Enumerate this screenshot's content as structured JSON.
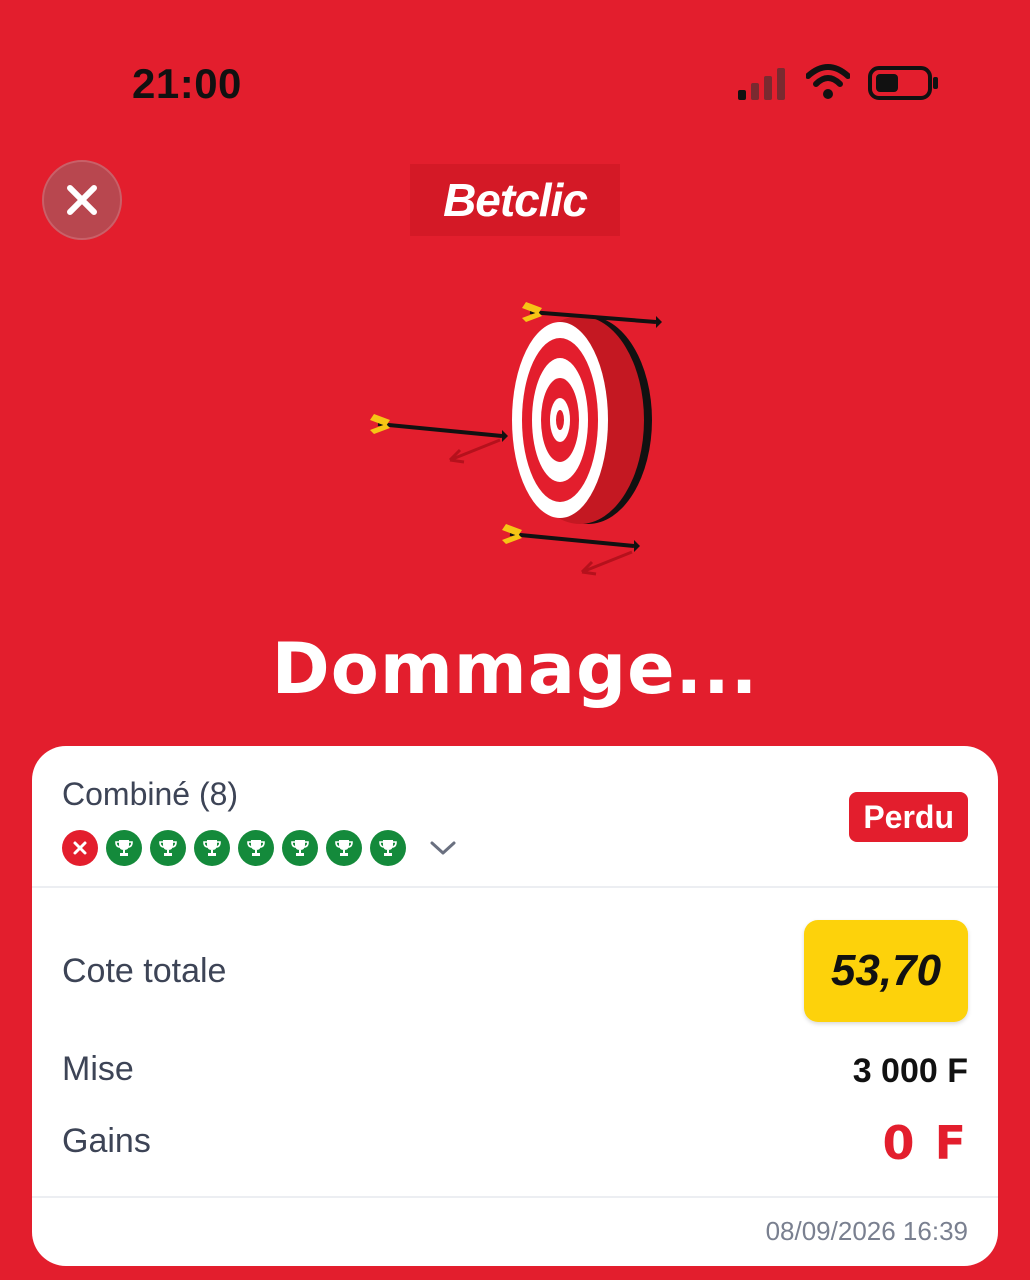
{
  "status_bar": {
    "time": "21:00"
  },
  "header": {
    "logo_text": "Betclic"
  },
  "result": {
    "headline": "Dommage..."
  },
  "bet": {
    "type_label": "Combiné (8)",
    "status": "Perdu",
    "legs": [
      "lost",
      "won",
      "won",
      "won",
      "won",
      "won",
      "won",
      "won"
    ],
    "odds_label": "Cote totale",
    "odds_value": "53,70",
    "stake_label": "Mise",
    "stake_value": "3 000 F",
    "winnings_label": "Gains",
    "winnings_value": "0 F",
    "timestamp": "08/09/2026 16:39"
  },
  "colors": {
    "brand_red": "#e31e2d",
    "won_green": "#148a3b",
    "odds_yellow": "#fdd20b"
  },
  "icons": {
    "close": "close-icon",
    "leg_lost": "cross-icon",
    "leg_won": "trophy-icon",
    "expand": "chevron-down-icon"
  }
}
